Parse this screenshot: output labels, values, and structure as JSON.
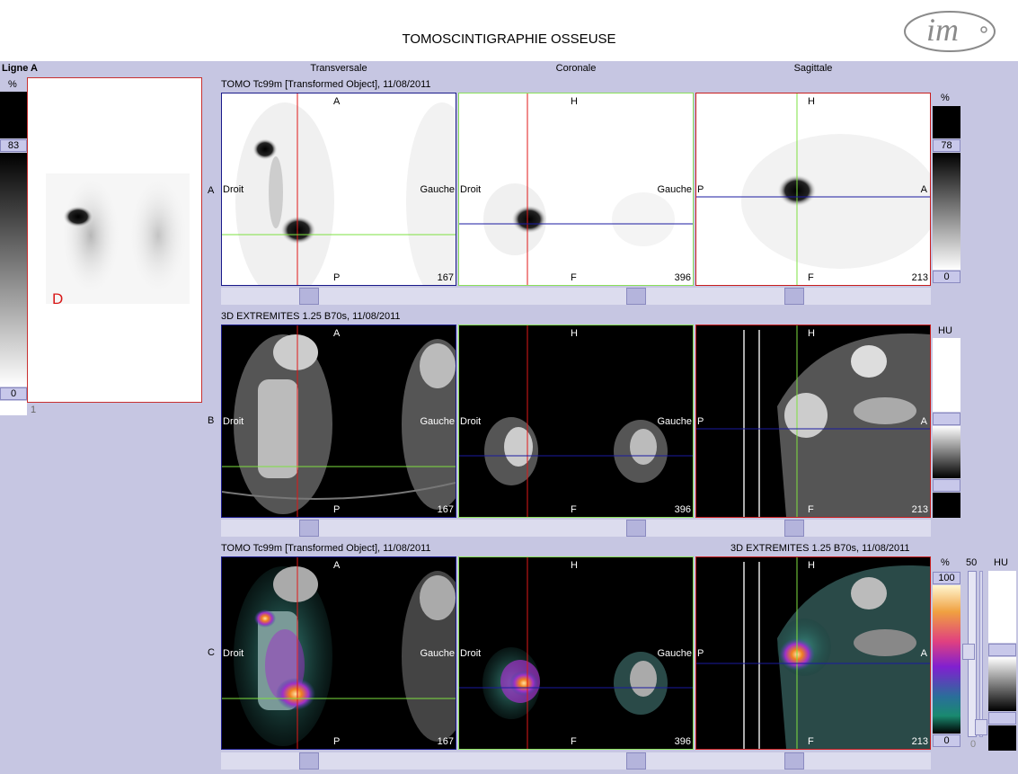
{
  "title": "TOMOSCINTIGRAPHIE OSSEUSE",
  "logo_text": "im",
  "left_panel": {
    "ligne_label": "Ligne A",
    "percent_label": "%",
    "top_value": "83",
    "bottom_value": "0",
    "frame_number": "1",
    "marker_letter": "D",
    "bottom_index": "1"
  },
  "columns": [
    "Transversale",
    "Coronale",
    "Sagittale"
  ],
  "rows": [
    {
      "letter": "A",
      "series_label": "TOMO Tc99m [Transformed Object], 11/08/2011",
      "series_label_right": ""
    },
    {
      "letter": "B",
      "series_label": "3D EXTREMITES  1.25  B70s, 11/08/2011",
      "series_label_right": ""
    },
    {
      "letter": "C",
      "series_label": "TOMO Tc99m [Transformed Object], 11/08/2011",
      "series_label_right": "3D EXTREMITES  1.25  B70s, 11/08/2011"
    }
  ],
  "view_labels": {
    "transverse": {
      "top": "A",
      "bottom": "P",
      "left": "Droit",
      "right": "Gauche",
      "slice": "167"
    },
    "coronal": {
      "top": "H",
      "bottom": "F",
      "left": "Droit",
      "right": "Gauche",
      "slice": "396"
    },
    "sagittal": {
      "top": "H",
      "bottom": "F",
      "left": "P",
      "right": "A",
      "slice": "213"
    }
  },
  "scale_a": {
    "unit": "%",
    "top": "78",
    "bottom": "0"
  },
  "scale_b": {
    "unit": "HU"
  },
  "scale_c": {
    "unit_pct": "%",
    "top": "100",
    "bottom": "0",
    "mid_value": "50",
    "unit_hu": "HU",
    "small_zero": "0"
  },
  "colors": {
    "background": "#c6c6e2",
    "transverse_frame": "#1a1a8a",
    "coronal_frame": "#8ae05a",
    "sagittal_frame": "#c81e1e",
    "crosshair_red": "#e01818",
    "crosshair_green": "#7ee040",
    "crosshair_blue": "#1a1aa0"
  }
}
